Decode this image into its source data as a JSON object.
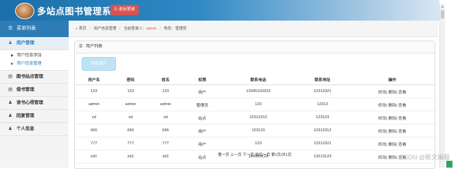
{
  "header": {
    "title": "多站点图书管理系统",
    "logout_label": "退出登录"
  },
  "sidebar": {
    "menu_title": "菜单列表",
    "items": [
      {
        "label": "用户管理",
        "sub": [
          "用户信息添加",
          "用户信息管理"
        ]
      },
      {
        "label": "图书站点管理"
      },
      {
        "label": "借书管理"
      },
      {
        "label": "读书心得管理"
      },
      {
        "label": "回复管理"
      },
      {
        "label": "个人信息"
      }
    ]
  },
  "breadcrumb": {
    "home": "首页",
    "page": "用户信息管理",
    "current_user_label": "当前登录人：",
    "current_user": "admin",
    "role_label": "角色：",
    "role": "管理员"
  },
  "panel": {
    "title": "用户列表",
    "add_button": "添加用户"
  },
  "table": {
    "headers": [
      "用户名",
      "密码",
      "姓名",
      "权限",
      "联系电话",
      "联系地址",
      "操作"
    ],
    "rows": [
      [
        "123",
        "123",
        "123",
        "用户",
        "13345102333",
        "12312321",
        "修改| 删除| 查看"
      ],
      [
        "admin",
        "admin",
        "admin",
        "管理员",
        "123",
        "12313",
        "修改| 删除| 查看"
      ],
      [
        "zd",
        "zd",
        "zd",
        "站点",
        "12312312",
        "123123",
        "修改| 删除| 查看"
      ],
      [
        "666",
        "666",
        "666",
        "用户",
        "123123",
        "12312312",
        "修改| 删除| 查看"
      ],
      [
        "777",
        "777",
        "777",
        "用户",
        "123",
        "12312321",
        "修改| 删除| 查看"
      ],
      [
        "zd1",
        "zd1",
        "zd1",
        "站点",
        "123123123",
        "13213123",
        "修改| 删除| 查看"
      ]
    ]
  },
  "pager": "第一页 上一页 下一页 最后一页 第1页/共1页",
  "watermark": "CSDN @斯文编程",
  "icons": {
    "avatar": "user-avatar",
    "logout": "power-icon",
    "menu": "list-icon",
    "user": "user-icon",
    "home": "home-icon"
  },
  "colors": {
    "accent": "#2d7cb6",
    "logout": "#d9534f",
    "add_button": "#bfe3f5"
  }
}
